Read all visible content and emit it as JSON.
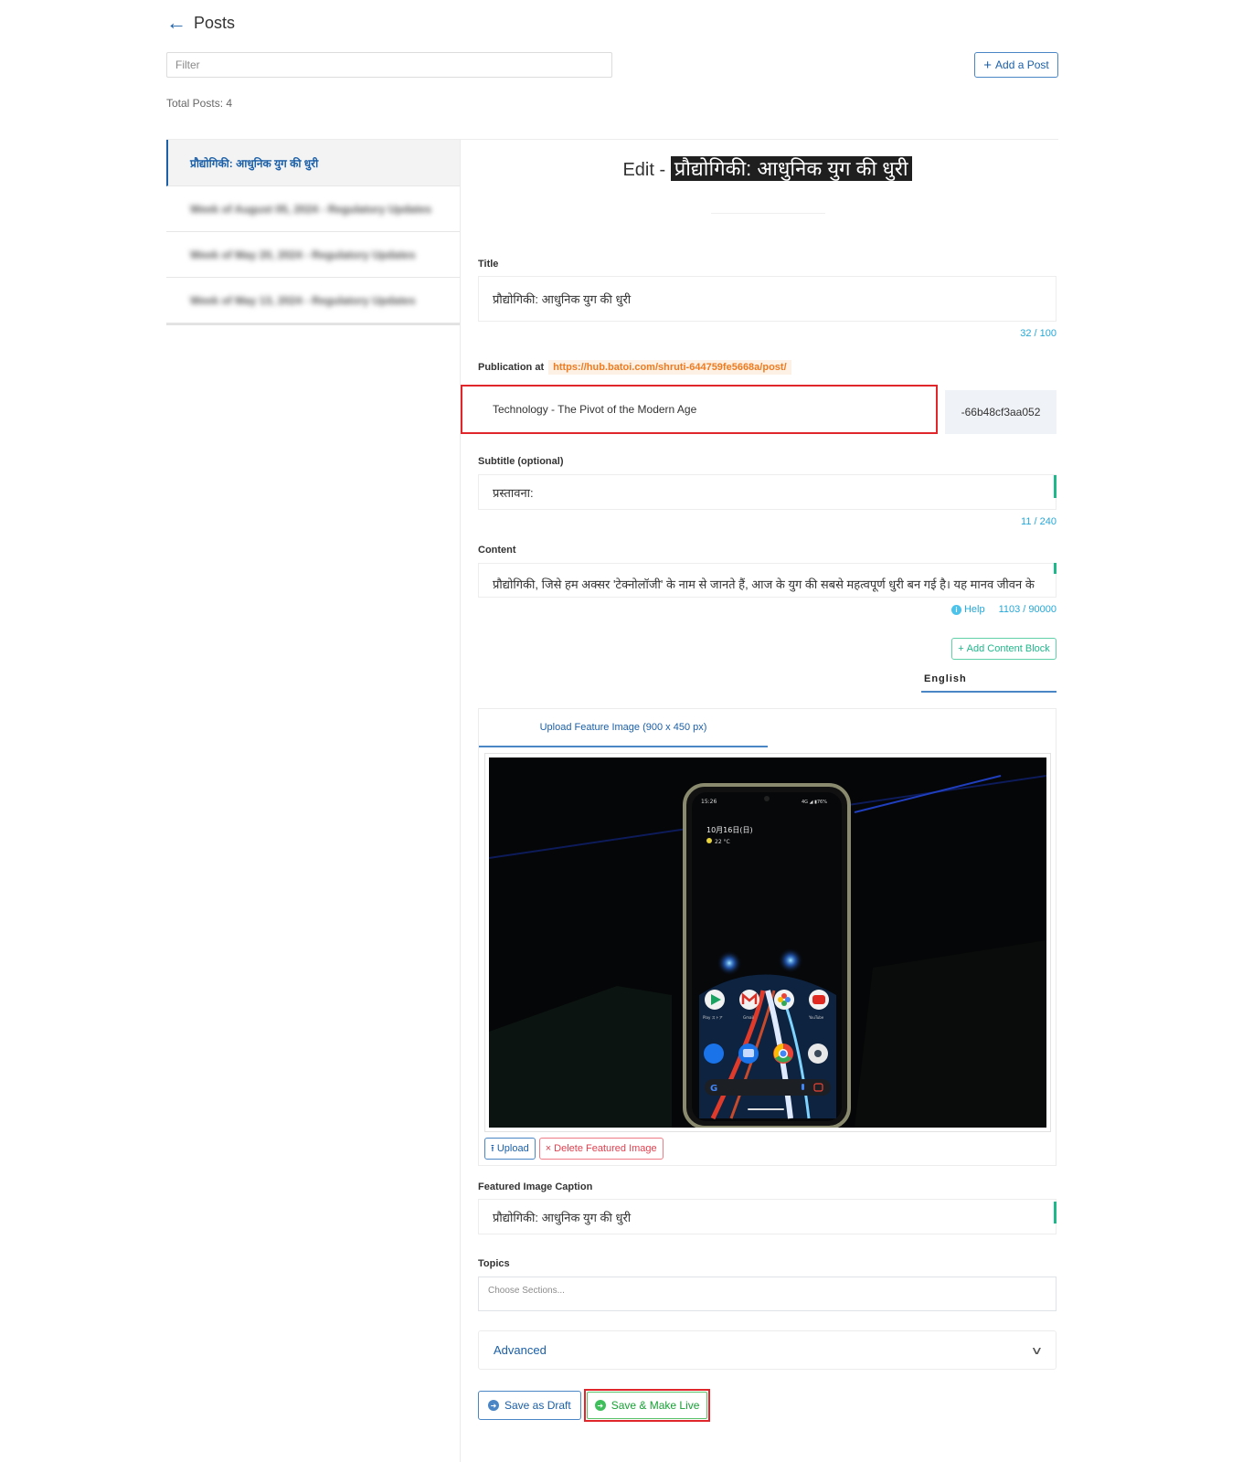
{
  "header": {
    "back_icon": "arrow-left-icon",
    "title": "Posts"
  },
  "filter": {
    "placeholder": "Filter",
    "value": ""
  },
  "add_post": {
    "icon": "plus-icon",
    "label": "Add a Post"
  },
  "total_posts": "Total Posts: 4",
  "post_list": [
    {
      "label": "प्रौद्योगिकी: आधुनिक युग की धुरी",
      "active": true,
      "blurred": false
    },
    {
      "label": "Week of August 05, 2024 - Regulatory Updates",
      "active": false,
      "blurred": true
    },
    {
      "label": "Week of May 20, 2024 - Regulatory Updates",
      "active": false,
      "blurred": true
    },
    {
      "label": "Week of May 13, 2024 - Regulatory Updates",
      "active": false,
      "blurred": true
    }
  ],
  "editor": {
    "heading_prefix": "Edit - ",
    "heading_title": "प्रौद्योगिकी: आधुनिक युग की धुरी",
    "title_label": "Title",
    "title_value": "प्रौद्योगिकी: आधुनिक युग की धुरी",
    "title_counter": "32 / 100",
    "publication_label": "Publication at",
    "publication_url": "https://hub.batoi.com/shruti-644759fe5668a/post/",
    "slug_value": "Technology - The Pivot of the Modern Age",
    "slug_suffix": "-66b48cf3aa052",
    "subtitle_label": "Subtitle (optional)",
    "subtitle_value": "प्रस्तावना:",
    "subtitle_counter": "11 / 240",
    "content_label": "Content",
    "content_value": "प्रौद्योगिकी, जिसे हम अक्सर 'टेक्नोलॉजी' के नाम से जानते हैं, आज के युग की सबसे महत्वपूर्ण धुरी बन गई है। यह मानव जीवन के",
    "help_icon": "info-icon",
    "help_label": "Help",
    "content_counter": "1103 / 90000",
    "add_block_label": "Add Content Block",
    "language_tab": "English",
    "image_tab": "Upload Feature Image (900 x 450 px)",
    "phone_time": "15:26",
    "phone_status": "4G ◢ ▮76%",
    "phone_date": "10月16日(日)",
    "phone_weather": "22 °C",
    "phone_apps": [
      "Play ストア",
      "Gmail",
      "フォト",
      "YouTube"
    ],
    "upload_label": "Upload",
    "delete_label": "Delete Featured Image",
    "caption_label": "Featured Image Caption",
    "caption_value": "प्रौद्योगिकी: आधुनिक युग की धुरी",
    "topics_label": "Topics",
    "topics_placeholder": "Choose Sections...",
    "advanced_label": "Advanced",
    "save_draft_label": "Save as Draft",
    "save_live_label": "Save & Make Live"
  },
  "colors": {
    "primary": "#1a5fa8",
    "accent_teal": "#1fb88a",
    "counter": "#23a8d8",
    "url_orange": "#f07b1e",
    "highlight_red": "#e0262b",
    "live_green": "#17a235"
  }
}
